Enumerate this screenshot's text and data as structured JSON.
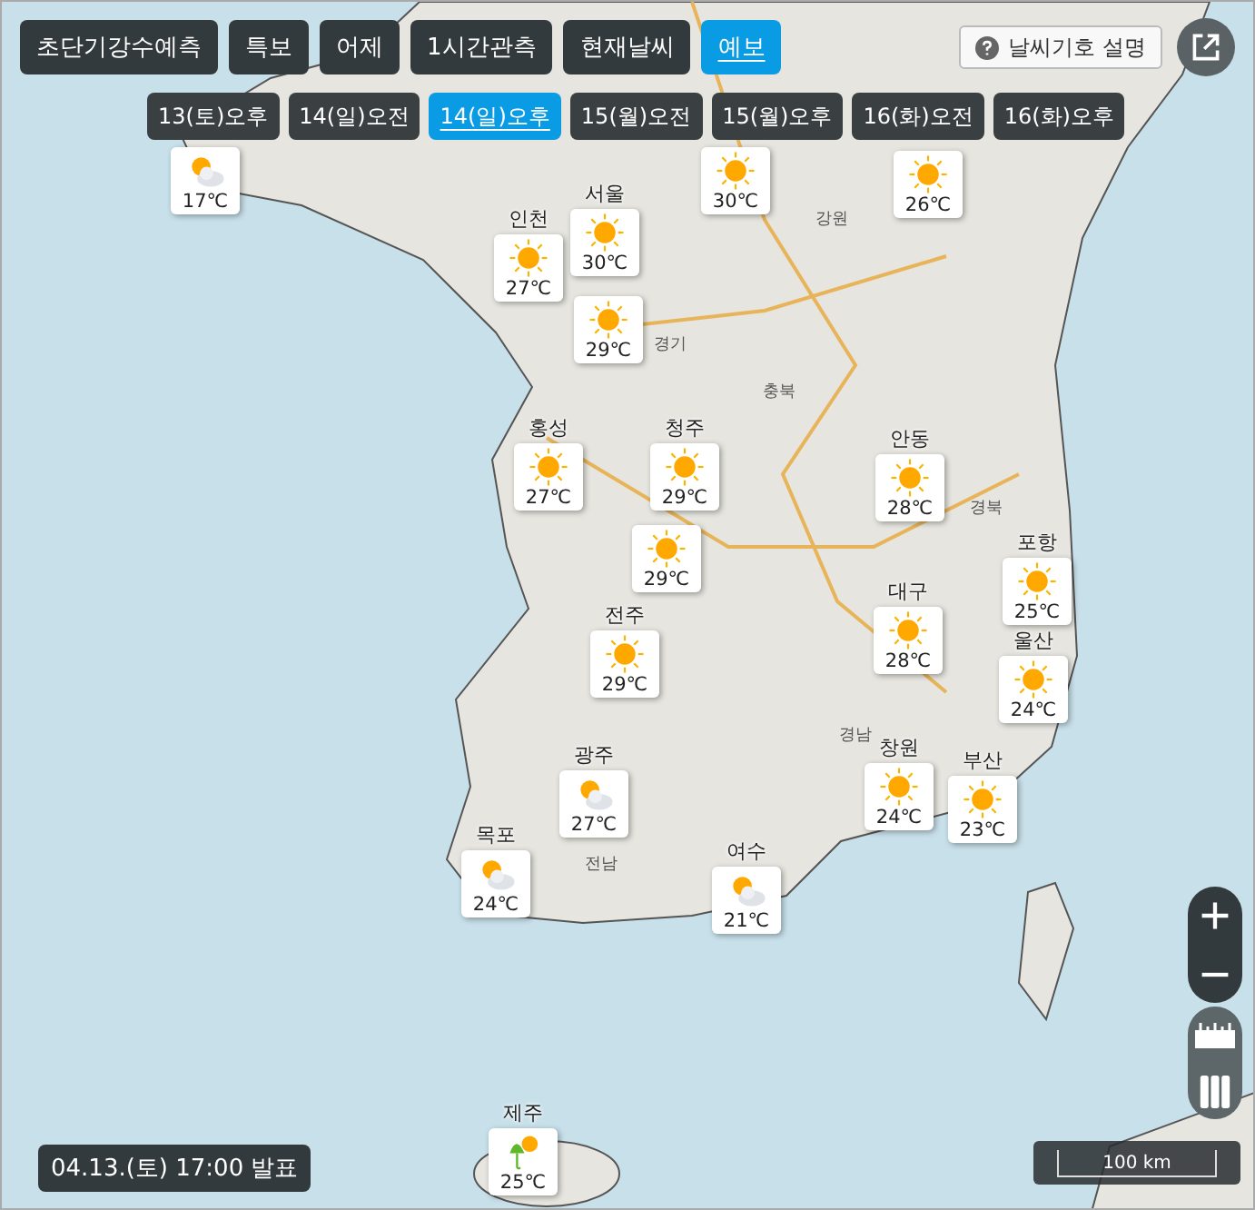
{
  "modes": [
    {
      "label": "초단기강수예측",
      "selected": false
    },
    {
      "label": "특보",
      "selected": false
    },
    {
      "label": "어제",
      "selected": false
    },
    {
      "label": "1시간관측",
      "selected": false
    },
    {
      "label": "현재날씨",
      "selected": false
    },
    {
      "label": "예보",
      "selected": true
    }
  ],
  "legend_button": {
    "label": "날씨기호 설명"
  },
  "times": [
    {
      "label": "13(토)오후",
      "selected": false
    },
    {
      "label": "14(일)오전",
      "selected": false
    },
    {
      "label": "14(일)오후",
      "selected": true
    },
    {
      "label": "15(월)오전",
      "selected": false
    },
    {
      "label": "15(월)오후",
      "selected": false
    },
    {
      "label": "16(화)오전",
      "selected": false
    },
    {
      "label": "16(화)오후",
      "selected": false
    }
  ],
  "regions": [
    "강원",
    "경기",
    "충북",
    "경북",
    "경남",
    "전남"
  ],
  "markers": [
    {
      "kind": "partly-cloudy",
      "temp": "17℃"
    },
    {
      "kind": "sunny",
      "temp": "30℃"
    },
    {
      "kind": "sunny",
      "temp": "26℃"
    },
    {
      "city": "인천",
      "kind": "sunny",
      "temp": "27℃"
    },
    {
      "city": "서울",
      "kind": "sunny",
      "temp": "30℃"
    },
    {
      "kind": "sunny",
      "temp": "29℃"
    },
    {
      "city": "홍성",
      "kind": "sunny",
      "temp": "27℃"
    },
    {
      "city": "청주",
      "kind": "sunny",
      "temp": "29℃"
    },
    {
      "kind": "sunny",
      "temp": "29℃"
    },
    {
      "city": "안동",
      "kind": "sunny",
      "temp": "28℃"
    },
    {
      "city": "포항",
      "kind": "sunny",
      "temp": "25℃"
    },
    {
      "city": "대구",
      "kind": "sunny",
      "temp": "28℃"
    },
    {
      "city": "울산",
      "kind": "sunny",
      "temp": "24℃"
    },
    {
      "city": "전주",
      "kind": "sunny",
      "temp": "29℃"
    },
    {
      "city": "광주",
      "kind": "partly-cloudy",
      "temp": "27℃"
    },
    {
      "city": "창원",
      "kind": "sunny",
      "temp": "24℃"
    },
    {
      "city": "부산",
      "kind": "sunny",
      "temp": "23℃"
    },
    {
      "city": "목포",
      "kind": "partly-cloudy",
      "temp": "24℃"
    },
    {
      "city": "여수",
      "kind": "partly-cloudy",
      "temp": "21℃"
    },
    {
      "city": "제주",
      "kind": "rain-sun",
      "temp": "25℃"
    }
  ],
  "scale": "100 km",
  "issued": "04.13.(토) 17:00 발표"
}
